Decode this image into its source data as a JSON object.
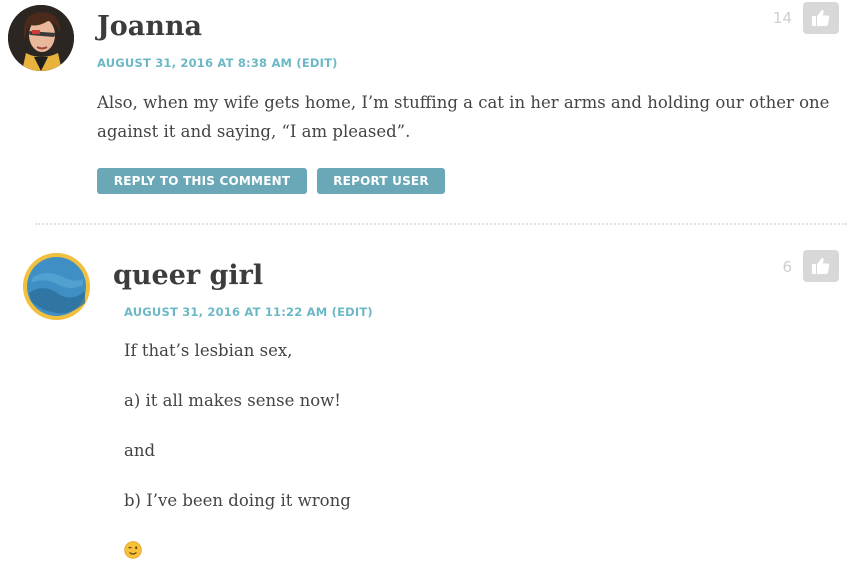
{
  "comments": [
    {
      "author": "Joanna",
      "date": "AUGUST 31, 2016 AT 8:38 AM",
      "edit_label": "(EDIT)",
      "paragraphs": [
        "Also, when my wife gets home, I’m stuffing a cat in her arms and holding our other one against it and saying, “I am pleased”."
      ],
      "likes": "14",
      "reply_label": "REPLY TO THIS COMMENT",
      "report_label": "REPORT USER"
    },
    {
      "author": "queer girl",
      "date": "AUGUST 31, 2016 AT 11:22 AM",
      "edit_label": "(EDIT)",
      "paragraphs": [
        "If that’s lesbian sex,",
        "a) it all makes sense now!",
        "and",
        "b) I’ve been doing it wrong",
        "😉"
      ],
      "likes": "6"
    }
  ],
  "colors": {
    "accent": "#6cb8c6",
    "button": "#6aa8b8",
    "like_button": "#d8d8d8",
    "avatar_ring": "#f0c040",
    "avatar_blue": "#3f8fc4"
  },
  "icons": {
    "like": "thumbs-up-icon"
  }
}
